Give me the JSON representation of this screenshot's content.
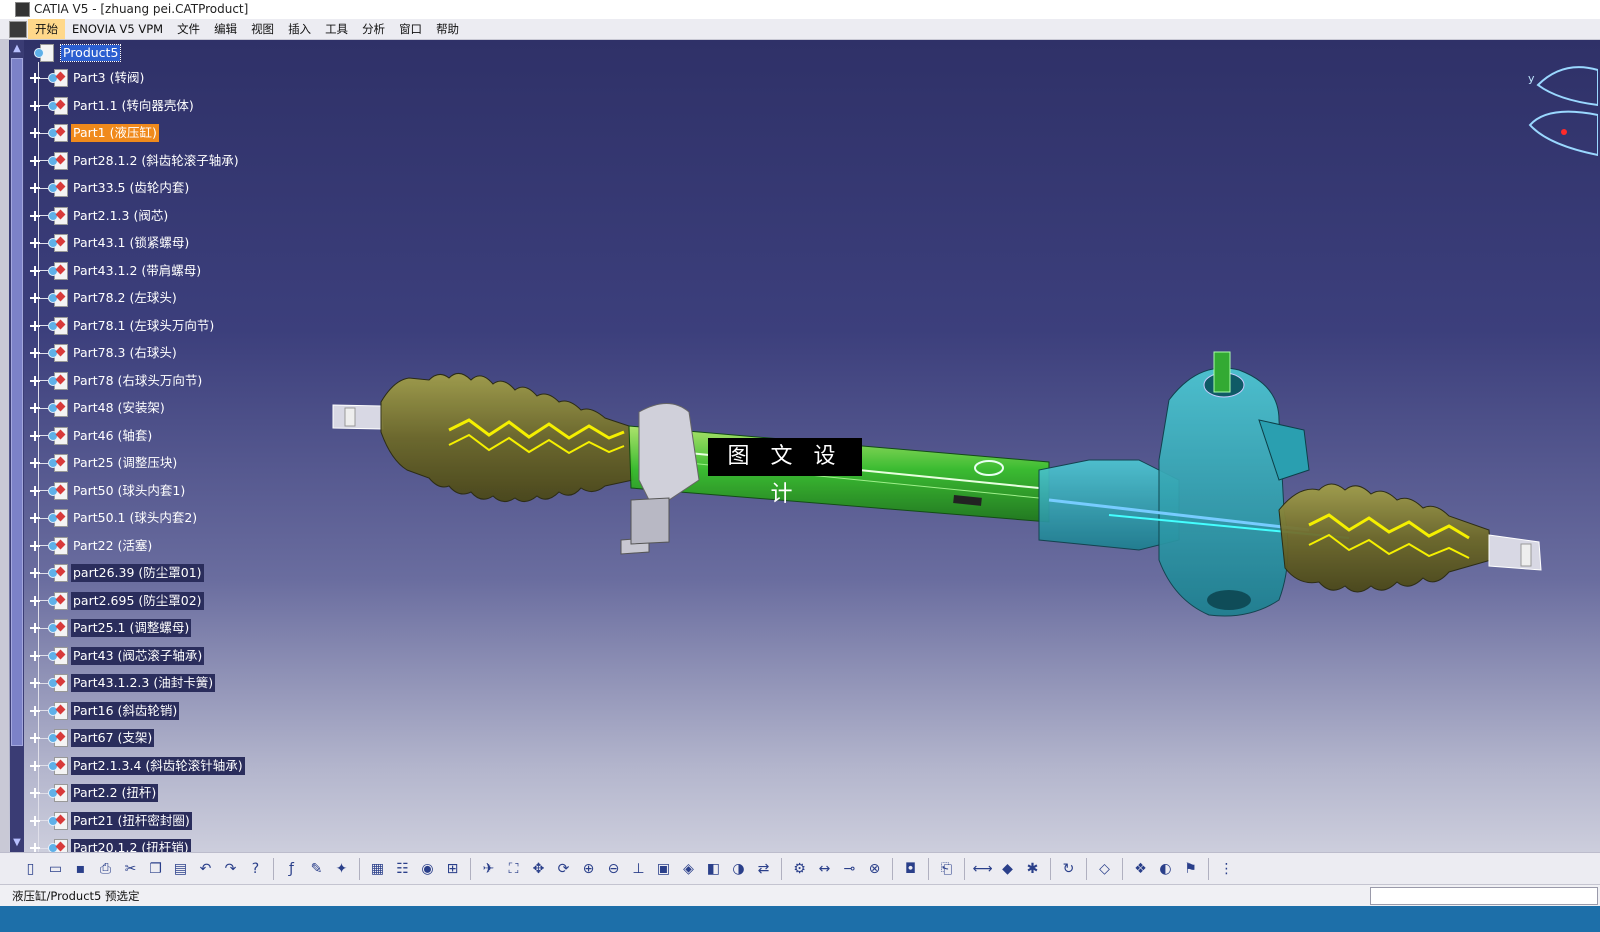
{
  "window": {
    "title": "CATIA V5 - [zhuang pei.CATProduct]"
  },
  "menu": {
    "items": [
      "开始",
      "ENOVIA V5 VPM",
      "文件",
      "编辑",
      "视图",
      "插入",
      "工具",
      "分析",
      "窗口",
      "帮助"
    ]
  },
  "tree": {
    "root": "Product5",
    "items": [
      "Part3 (转阀)",
      "Part1.1 (转向器壳体)",
      "Part1 (液压缸)",
      "Part28.1.2 (斜齿轮滚子轴承)",
      "Part33.5 (齿轮内套)",
      "Part2.1.3 (阀芯)",
      "Part43.1 (锁紧螺母)",
      "Part43.1.2 (带肩螺母)",
      "Part78.2 (左球头)",
      "Part78.1 (左球头万向节)",
      "Part78.3 (右球头)",
      "Part78 (右球头万向节)",
      "Part48 (安装架)",
      "Part46 (轴套)",
      "Part25 (调整压块)",
      "Part50 (球头内套1)",
      "Part50.1 (球头内套2)",
      "Part22 (活塞)",
      "part26.39 (防尘罩01)",
      "part2.695 (防尘罩02)",
      "Part25.1 (调整螺母)",
      "Part43 (阀芯滚子轴承)",
      "Part43.1.2.3 (油封卡簧)",
      "Part16 (斜齿轮销)",
      "Part67 (支架)",
      "Part2.1.3.4 (斜齿轮滚针轴承)",
      "Part2.2 (扭杆)",
      "Part21 (扭杆密封圈)",
      "Part20.1.2 (扭杆销)"
    ],
    "selected_index": 2
  },
  "viewport": {
    "watermark": "图 文 设 计",
    "axis_label": "y"
  },
  "toolbar": {
    "icons": [
      "new-icon",
      "open-icon",
      "save-icon",
      "print-icon",
      "cut-icon",
      "copy-icon",
      "paste-icon",
      "undo-icon",
      "redo-icon",
      "whats-this-icon",
      "sep",
      "formula-icon",
      "comment-icon",
      "light-icon",
      "sep",
      "table-icon",
      "catalog-icon",
      "knowledge-icon",
      "tree-icon",
      "sep",
      "fly-icon",
      "fit-all-icon",
      "pan-icon",
      "rotate-icon",
      "zoom-in-icon",
      "zoom-out-icon",
      "normal-view-icon",
      "multi-view-icon",
      "iso-view-icon",
      "render-style-icon",
      "hide-show-icon",
      "swap-space-icon",
      "sep",
      "component-icon",
      "move-icon",
      "snap-icon",
      "constraint-icon",
      "sep",
      "capture-icon",
      "sep",
      "publish-icon",
      "sep",
      "measure-icon",
      "inertia-icon",
      "clash-icon",
      "sep",
      "refresh-icon",
      "sep",
      "apply-material-icon",
      "sep",
      "scene-icon",
      "sectioning-icon",
      "analysis-icon",
      "sep",
      "grid-icon"
    ]
  },
  "status": {
    "text": "液压缸/Product5 预选定",
    "command_input": ""
  }
}
